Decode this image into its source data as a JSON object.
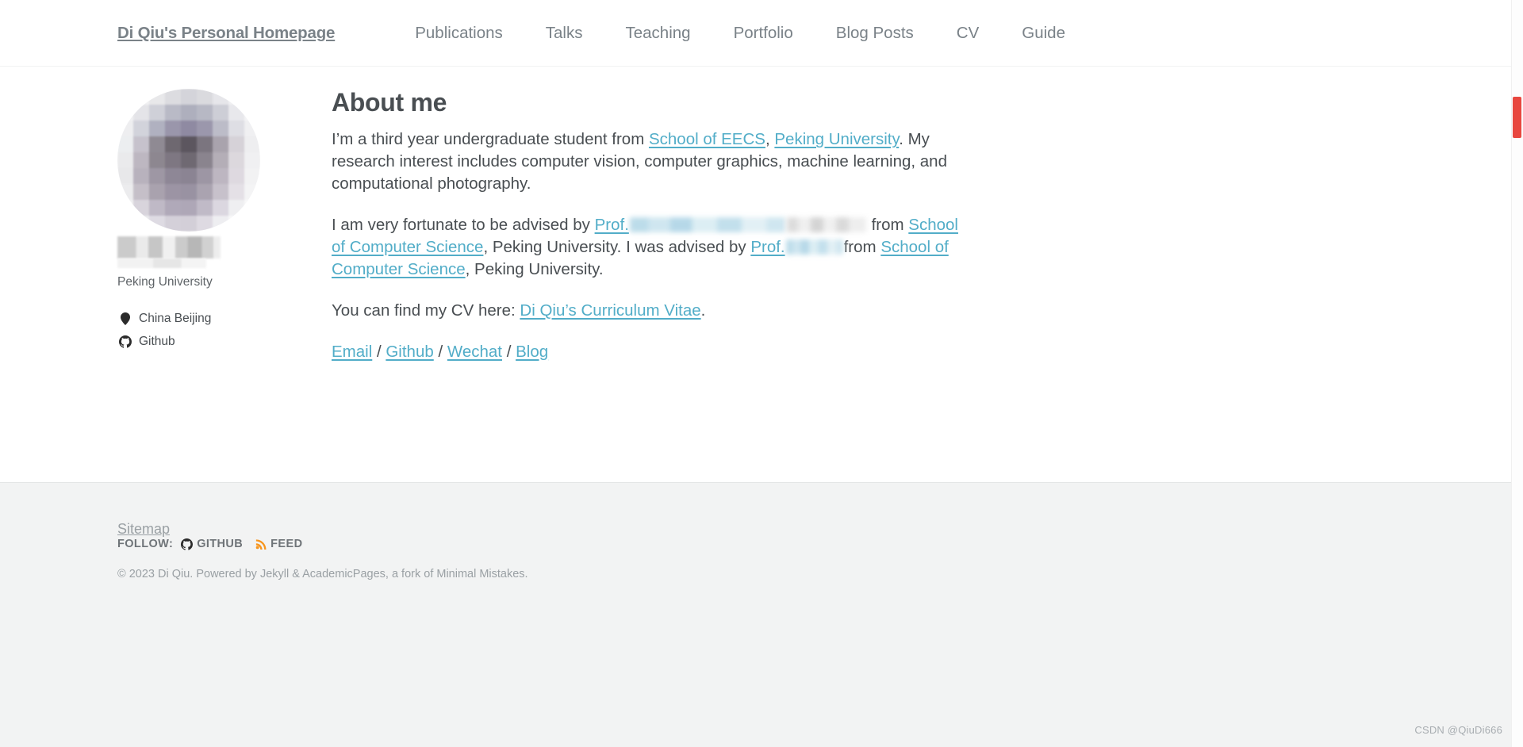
{
  "masthead": {
    "site_title": "Di Qiu's Personal Homepage",
    "nav": [
      {
        "label": "Publications"
      },
      {
        "label": "Talks"
      },
      {
        "label": "Teaching"
      },
      {
        "label": "Portfolio"
      },
      {
        "label": "Blog Posts"
      },
      {
        "label": "CV"
      },
      {
        "label": "Guide"
      }
    ]
  },
  "sidebar": {
    "avatar_alt": "author-avatar",
    "author_name_redacted": "",
    "bio": "Peking University",
    "links": [
      {
        "icon": "map-marker-icon",
        "label": "China Beijing"
      },
      {
        "icon": "github-icon",
        "label": "Github"
      }
    ]
  },
  "content": {
    "title": "About me",
    "p1": {
      "t1": "I’m a third year undergraduate student from ",
      "link1": "School of EECS",
      "t2": ", ",
      "link2": "Peking University",
      "t3": ". My research interest includes computer vision, computer graphics, machine learning, and computational photography."
    },
    "p2": {
      "t1": "I am very fortunate to be advised by ",
      "link1": "Prof.",
      "t2": " from ",
      "link2": "School of Computer Science",
      "t3": ", Peking University. I was advised by ",
      "link3": "Prof.",
      "t4": "from ",
      "link4": "School of Computer Science",
      "t5": ", Peking University."
    },
    "p3": {
      "t1": "You can find my CV here: ",
      "link1": "Di Qiu’s Curriculum Vitae",
      "t2": "."
    },
    "p4": {
      "link1": "Email",
      "sep1": " / ",
      "link2": "Github",
      "sep2": " / ",
      "link3": "Wechat",
      "sep3": " / ",
      "link4": "Blog"
    }
  },
  "footer": {
    "sitemap": "Sitemap",
    "follow_label": "FOLLOW:",
    "follow_items": [
      {
        "icon": "github-icon",
        "label": "GITHUB"
      },
      {
        "icon": "rss-icon",
        "label": "FEED"
      }
    ],
    "copyright": "© 2023 Di Qiu. Powered by Jekyll & AcademicPages, a fork of Minimal Mistakes."
  },
  "watermark": "CSDN @QiuDi666",
  "colors": {
    "link": "#52adc8",
    "text": "#494e52",
    "muted": "#7a8288",
    "footer_bg": "#f2f3f3",
    "scrollbar_thumb": "#e8473f",
    "rss_orange": "#f7951d"
  }
}
